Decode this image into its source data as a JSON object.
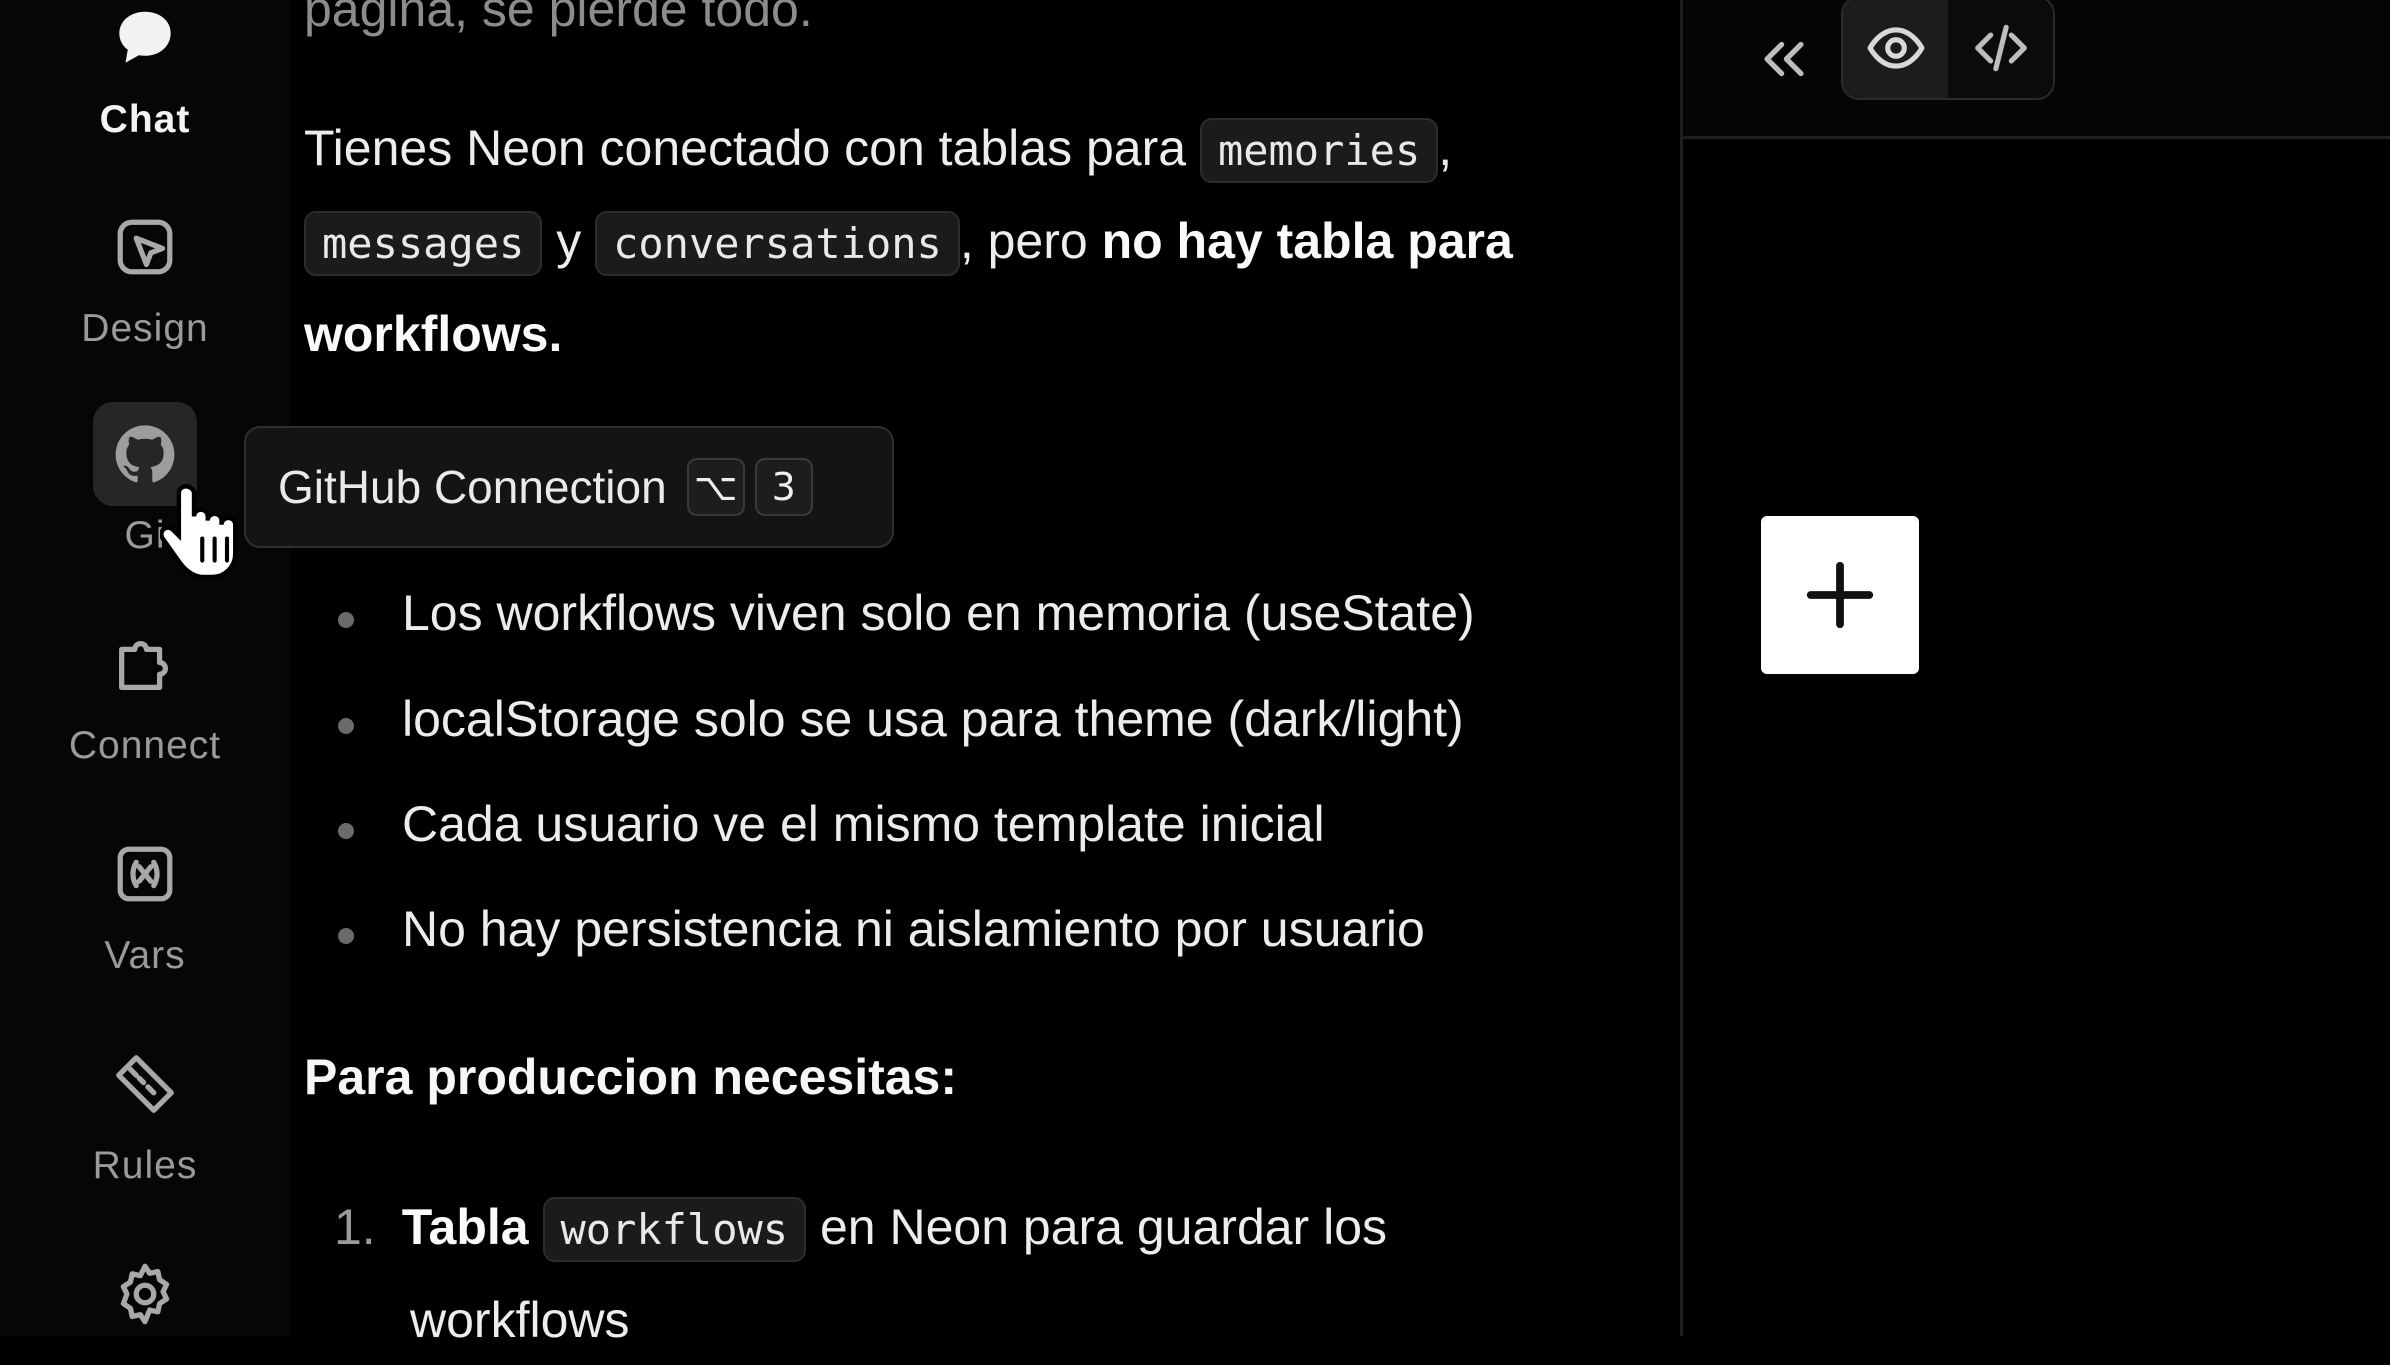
{
  "rail": {
    "items": [
      {
        "label": "Chat",
        "icon": "chat-bubble-icon",
        "active": true
      },
      {
        "label": "Design",
        "icon": "design-cursor-icon",
        "active": false
      },
      {
        "label": "Gi",
        "icon": "github-icon",
        "active": false,
        "hovered": true
      },
      {
        "label": "Connect",
        "icon": "puzzle-icon",
        "active": false
      },
      {
        "label": "Vars",
        "icon": "variable-icon",
        "active": false
      },
      {
        "label": "Rules",
        "icon": "ruler-icon",
        "active": false
      },
      {
        "label": "",
        "icon": "gear-icon",
        "active": false
      }
    ]
  },
  "tooltip": {
    "label": "GitHub Connection",
    "keys": [
      "⌥",
      "3"
    ]
  },
  "chat": {
    "faded_top": "pagina, se pierde todo.",
    "p1": {
      "t1": "Tienes Neon conectado con tablas para ",
      "c1": "memories",
      "t2": ",",
      "c2": "messages",
      "t3": " y ",
      "c3": "conversations",
      "t4": ", pero ",
      "b1": "no hay tabla para",
      "b2": "workflows."
    },
    "bullets": [
      "Los workflows viven solo en memoria (useState)",
      "localStorage solo se usa para theme (dark/light)",
      "Cada usuario ve el mismo template inicial",
      "No hay persistencia ni aislamiento por usuario"
    ],
    "heading": "Para produccion necesitas:",
    "list": {
      "num": "1.",
      "b": "Tabla",
      "code": "workflows",
      "t1": " en Neon para guardar los",
      "t2": "workflows"
    }
  },
  "preview": {
    "collapse_icon": "chevrons-left-icon",
    "view_icons": [
      "eye-icon",
      "code-icon"
    ],
    "add_icon": "plus-icon"
  }
}
